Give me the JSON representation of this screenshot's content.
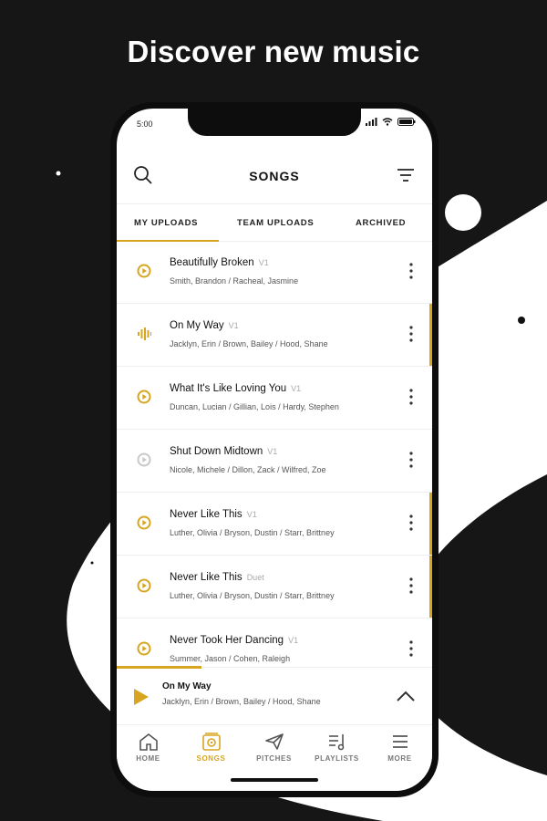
{
  "headline": "Discover new music",
  "status_bar": {
    "time": "5:00"
  },
  "header": {
    "title": "SONGS"
  },
  "tabs": [
    {
      "label": "MY UPLOADS",
      "active": true
    },
    {
      "label": "TEAM UPLOADS",
      "active": false
    },
    {
      "label": "ARCHIVED",
      "active": false
    }
  ],
  "songs": [
    {
      "title": "Beautifully Broken",
      "version": "V1",
      "artists": "Smith, Brandon / Racheal, Jasmine",
      "state": "play"
    },
    {
      "title": "On My Way",
      "version": "V1",
      "artists": "Jacklyn, Erin / Brown, Bailey / Hood, Shane",
      "state": "playing"
    },
    {
      "title": "What It's Like Loving You",
      "version": "V1",
      "artists": "Duncan, Lucian / Gillian, Lois / Hardy, Stephen",
      "state": "play"
    },
    {
      "title": "Shut Down Midtown",
      "version": "V1",
      "artists": "Nicole, Michele / Dillon, Zack / Wilfred, Zoe",
      "state": "disabled"
    },
    {
      "title": "Never Like This",
      "version": "V1",
      "artists": "Luther, Olivia / Bryson, Dustin / Starr, Brittney",
      "state": "play"
    },
    {
      "title": "Never Like This",
      "version": "Duet",
      "artists": "Luther, Olivia / Bryson, Dustin / Starr, Brittney",
      "state": "play"
    },
    {
      "title": "Never Took Her Dancing",
      "version": "V1",
      "artists": "Summer, Jason / Cohen, Raleigh",
      "state": "play"
    }
  ],
  "now_playing": {
    "title": "On My Way",
    "artists": "Jacklyn, Erin / Brown, Bailey / Hood, Shane",
    "progress": 0.27
  },
  "bottom_nav": [
    {
      "label": "HOME",
      "icon": "home-icon",
      "active": false
    },
    {
      "label": "SONGS",
      "icon": "songs-icon",
      "active": true
    },
    {
      "label": "PITCHES",
      "icon": "paper-plane-icon",
      "active": false
    },
    {
      "label": "PLAYLISTS",
      "icon": "playlist-icon",
      "active": false
    },
    {
      "label": "MORE",
      "icon": "menu-icon",
      "active": false
    }
  ],
  "colors": {
    "accent": "#d8a520",
    "background": "#161616",
    "inactive_play": "#c8c8c8"
  }
}
